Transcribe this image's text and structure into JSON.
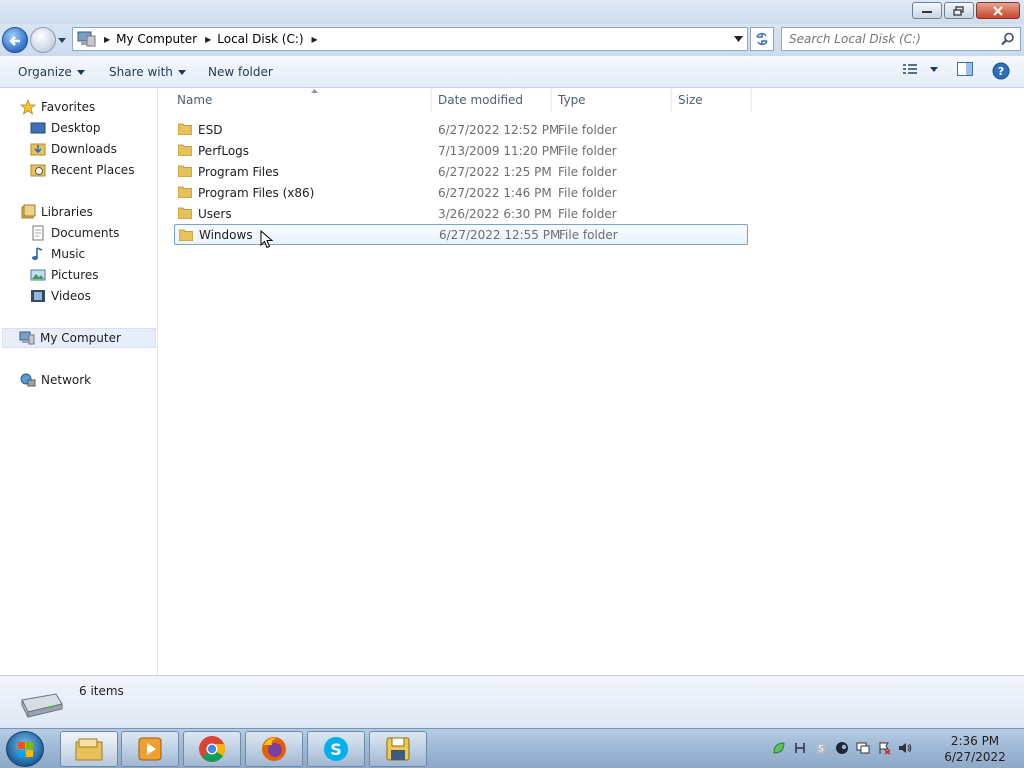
{
  "titlebar": {
    "buttons": [
      "minimize",
      "maximize",
      "close"
    ]
  },
  "address": {
    "crumbs": [
      "My Computer",
      "Local Disk (C:)"
    ],
    "search_placeholder": "Search Local Disk (C:)"
  },
  "toolbar": {
    "organize": "Organize",
    "share_with": "Share with",
    "new_folder": "New folder"
  },
  "nav": {
    "favorites": "Favorites",
    "desktop": "Desktop",
    "downloads": "Downloads",
    "recent_places": "Recent Places",
    "libraries": "Libraries",
    "documents": "Documents",
    "music": "Music",
    "pictures": "Pictures",
    "videos": "Videos",
    "my_computer": "My Computer",
    "network": "Network"
  },
  "columns": {
    "name": "Name",
    "date": "Date modified",
    "type": "Type",
    "size": "Size"
  },
  "files": [
    {
      "name": "ESD",
      "date": "6/27/2022 12:52 PM",
      "type": "File folder"
    },
    {
      "name": "PerfLogs",
      "date": "7/13/2009 11:20 PM",
      "type": "File folder"
    },
    {
      "name": "Program Files",
      "date": "6/27/2022 1:25 PM",
      "type": "File folder"
    },
    {
      "name": "Program Files (x86)",
      "date": "6/27/2022 1:46 PM",
      "type": "File folder"
    },
    {
      "name": "Users",
      "date": "3/26/2022 6:30 PM",
      "type": "File folder"
    },
    {
      "name": "Windows",
      "date": "6/27/2022 12:55 PM",
      "type": "File folder"
    }
  ],
  "status": {
    "count": "6 items"
  },
  "taskbar": {
    "apps": [
      "explorer-icon",
      "media-player-icon",
      "chrome-icon",
      "firefox-icon",
      "skype-icon",
      "save-disk-icon"
    ],
    "time": "2:36 PM",
    "date": "6/27/2022"
  },
  "colors": {
    "accent": "#1e395b",
    "selection_border": "#7da2ce",
    "folder": "#e8c15a"
  }
}
